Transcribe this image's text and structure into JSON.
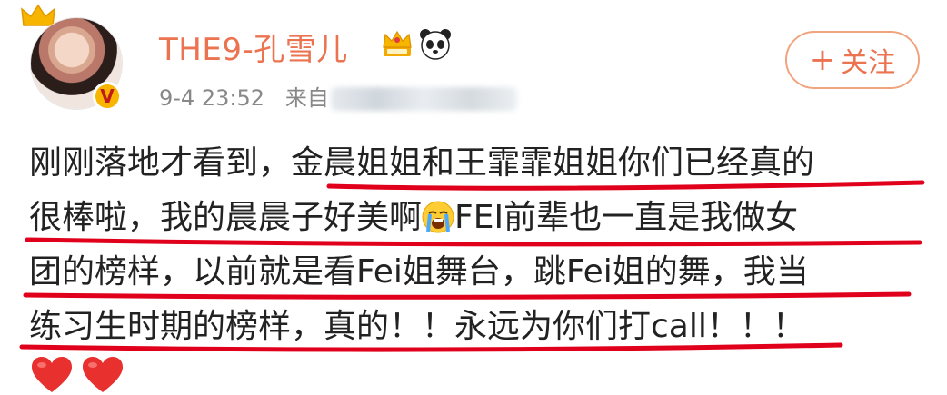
{
  "user": {
    "name": "THE9-孔雪儿",
    "avatar_icon": "user-avatar",
    "verified_mark": "V",
    "badges": [
      "crown-badge-icon",
      "panda-badge-icon"
    ]
  },
  "post": {
    "time": "9-4 23:52",
    "source_label": "来自",
    "lines": [
      "刚刚落地才看到，金晨姐姐和王霏霏姐姐你们已经真的",
      "很棒啦，我的晨晨子好美啊",
      "FEI前辈也一直是我做女",
      "团的榜样，以前就是看Fei姐舞台，跳Fei姐的舞，我当",
      "练习生时期的榜样，真的！！永远为你们打call！！！"
    ],
    "emoji": "loudly-crying-face",
    "hearts": [
      "red-heart",
      "red-heart"
    ]
  },
  "follow_button": {
    "plus": "+",
    "label": "关注"
  },
  "colors": {
    "accent": "#eb7350",
    "underline": "#e0001b",
    "text": "#222222",
    "meta": "#888888"
  }
}
